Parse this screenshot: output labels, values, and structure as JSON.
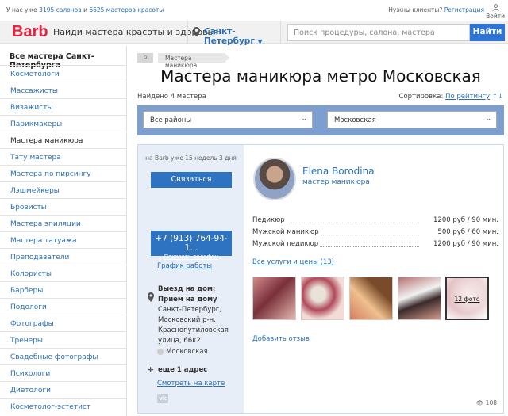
{
  "topbar": {
    "prefix": "У нас уже",
    "salons": "3195 салонов",
    "and": "и",
    "masters": "6625 мастеров красоты",
    "need_clients": "Нужны клиенты?",
    "register": "Регистрация",
    "login": "Войти"
  },
  "header": {
    "logo": "Barb",
    "tagline": "Найди мастера красоты и здоровья",
    "city": "Санкт-Петербург",
    "search_placeholder": "Поиск процедуры, салона, мастера",
    "find": "Найти"
  },
  "sidebar": {
    "title": "Все мастера Санкт-Петербурга",
    "items": [
      {
        "label": "Косметологи"
      },
      {
        "label": "Массажисты"
      },
      {
        "label": "Визажисты"
      },
      {
        "label": "Парикмахеры"
      },
      {
        "label": "Мастера маникюра",
        "active": true
      },
      {
        "label": "Тату мастера"
      },
      {
        "label": "Мастера по пирсингу"
      },
      {
        "label": "Лэшмейкеры"
      },
      {
        "label": "Бровисты"
      },
      {
        "label": "Мастера эпиляции"
      },
      {
        "label": "Мастера татуажа"
      },
      {
        "label": "Преподаватели"
      },
      {
        "label": "Колористы"
      },
      {
        "label": "Барберы"
      },
      {
        "label": "Подологи"
      },
      {
        "label": "Фотографы"
      },
      {
        "label": "Тренеры"
      },
      {
        "label": "Свадебные фотографы"
      },
      {
        "label": "Психологи"
      },
      {
        "label": "Диетологи"
      },
      {
        "label": "Косметолог-эстетист"
      }
    ]
  },
  "breadcrumb": {
    "current": "Мастера маникюра"
  },
  "page_title": "Мастера маникюра метро Московская",
  "found": "Найдено 4 мастера",
  "sort": {
    "label": "Сортировка:",
    "value": "По рейтингу"
  },
  "filters": {
    "district": "Все районы",
    "metro": "Московская"
  },
  "card": {
    "since": "на Barb уже 15 недель 3 дня",
    "contact": "Связаться",
    "phone": "+7 (913) 764-94-1...",
    "show_phone": "Показать телефон",
    "schedule": "График работы",
    "visit_label": "Выезд на дом:",
    "visit_value": "Прием на дому",
    "address": [
      "Санкт-Петербург,",
      "Московский р-н,",
      "Краснопутиловская",
      "улица, 66к2"
    ],
    "metro": "Московская",
    "more_addr": "еще 1 адрес",
    "map": "Смотреть на карте",
    "vk": "vk",
    "name": "Elena Borodina",
    "role": "мастер маникюра",
    "services": [
      {
        "name": "Педикюр",
        "price": "1200 руб / 90 мин."
      },
      {
        "name": "Мужской маникюр",
        "price": "500 руб / 60 мин."
      },
      {
        "name": "Мужской педикюр",
        "price": "1200 руб / 90 мин."
      }
    ],
    "all_services": "Все услуги и цены (13)",
    "photos_count": "12 фото",
    "add_review": "Добавить отзыв",
    "views": "108"
  },
  "colors": {
    "accent": "#2e73c1",
    "brand": "#e5243f",
    "filter_bg": "#7d9fd0"
  }
}
